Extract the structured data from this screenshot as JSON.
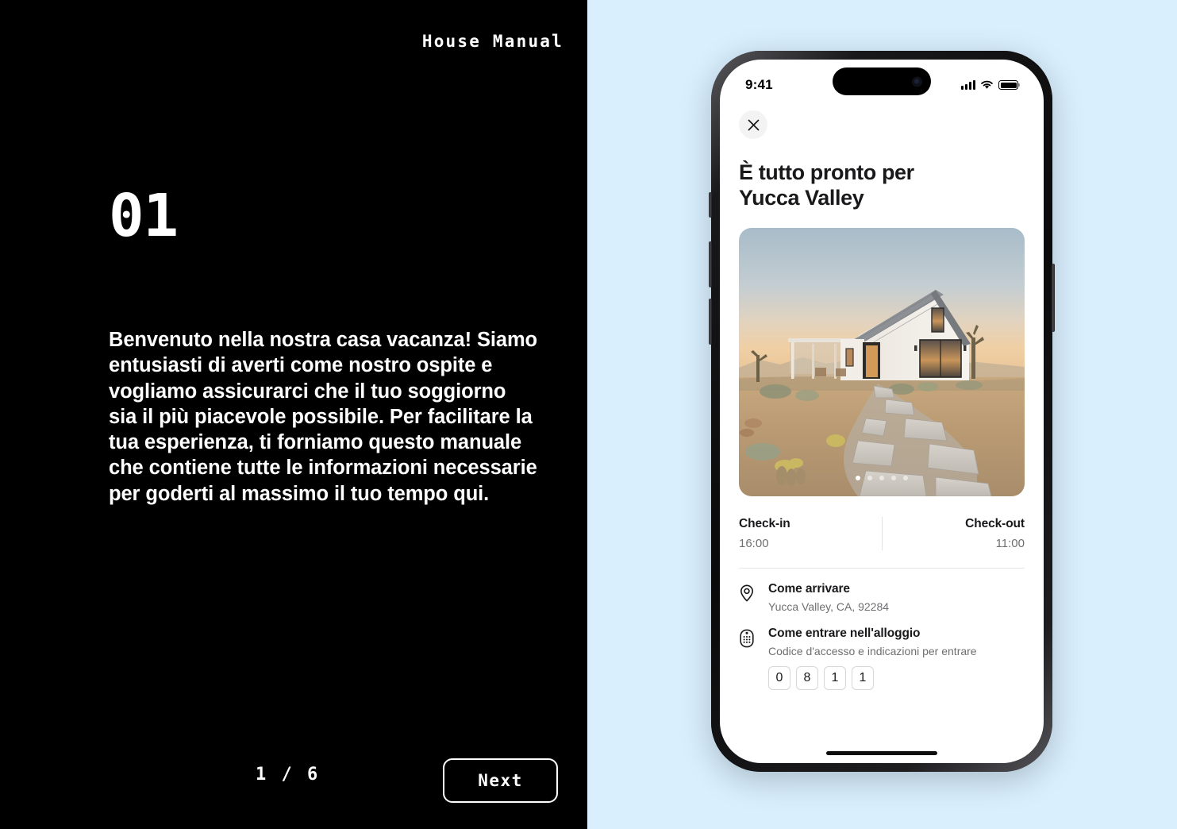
{
  "slide": {
    "header_title": "House Manual",
    "step_number": "01",
    "body_text": "Benvenuto nella nostra casa vacanza! Siamo entusiasti di averti come nostro ospite e vogliamo assicurarci che il tuo soggiorno sia il più piacevole possibile. Per facilitare la tua esperienza, ti forniamo questo manuale che contiene tutte le informazioni necessarie per goderti al massimo il tuo tempo qui.",
    "pager_text": "1 / 6",
    "next_label": "Next",
    "background_color": "#000000",
    "text_color": "#ffffff"
  },
  "right_panel": {
    "background_color": "#d9effe"
  },
  "phone": {
    "status_bar": {
      "time": "9:41",
      "signal_icon": "cellular-signal-icon",
      "wifi_icon": "wifi-icon",
      "battery_icon": "battery-full-icon"
    },
    "close_icon": "close-icon",
    "screen_title_line1": "È tutto pronto per",
    "screen_title_line2": "Yucca Valley",
    "hero": {
      "alt": "Modern white desert farmhouse at dusk with stone pathway",
      "carousel_total": 5,
      "carousel_active": 1
    },
    "checkin": {
      "label": "Check-in",
      "value": "16:00"
    },
    "checkout": {
      "label": "Check-out",
      "value": "11:00"
    },
    "info_items": [
      {
        "icon": "map-pin-icon",
        "title": "Come arrivare",
        "subtitle": "Yucca Valley, CA, 92284"
      },
      {
        "icon": "keypad-lock-icon",
        "title": "Come entrare nell'alloggio",
        "subtitle": "Codice d'accesso e indicazioni per entrare"
      }
    ],
    "access_code": [
      "0",
      "8",
      "1",
      "1"
    ]
  }
}
